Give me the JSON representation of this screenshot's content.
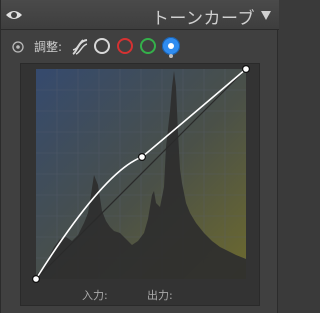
{
  "header": {
    "title": "トーンカーブ"
  },
  "adjust": {
    "label": "調整:",
    "selected_channel": "blue",
    "channels": [
      "rgb",
      "red",
      "green",
      "blue"
    ]
  },
  "colors": {
    "red_channel": "#d53232",
    "green_channel": "#34b04a",
    "blue_channel": "#2f8cf0",
    "curve": "#ffffff"
  },
  "curve": {
    "points": [
      {
        "in": 0,
        "out": 0
      },
      {
        "in": 0.5,
        "out": 0.56
      },
      {
        "in": 1,
        "out": 1
      }
    ]
  },
  "footer": {
    "input_label": "入力:",
    "output_label": "出力:"
  }
}
